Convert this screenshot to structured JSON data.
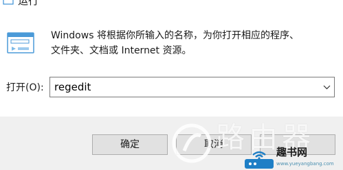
{
  "window": {
    "title": "运行",
    "icon": "run-app-icon"
  },
  "dialog": {
    "description": "Windows 将根据你所输入的名称，为你打开相应的程序、\n文件夹、文档或 Internet 资源。",
    "open_label": "打开(O):",
    "open_value": "regedit",
    "dropdown_icon": "chevron-down-icon"
  },
  "buttons": {
    "ok": "确定",
    "cancel": "取消"
  },
  "watermark": {
    "big_text": "路由器",
    "site_name": "趣书网",
    "site_url": "www.yueyangbang.com"
  },
  "colors": {
    "footer_bg": "#f0f0f0",
    "button_bg": "#e1e1e1",
    "button_border": "#adadad",
    "icon_blue": "#3b8fd6",
    "watermark_blue": "#1e7fc6"
  }
}
